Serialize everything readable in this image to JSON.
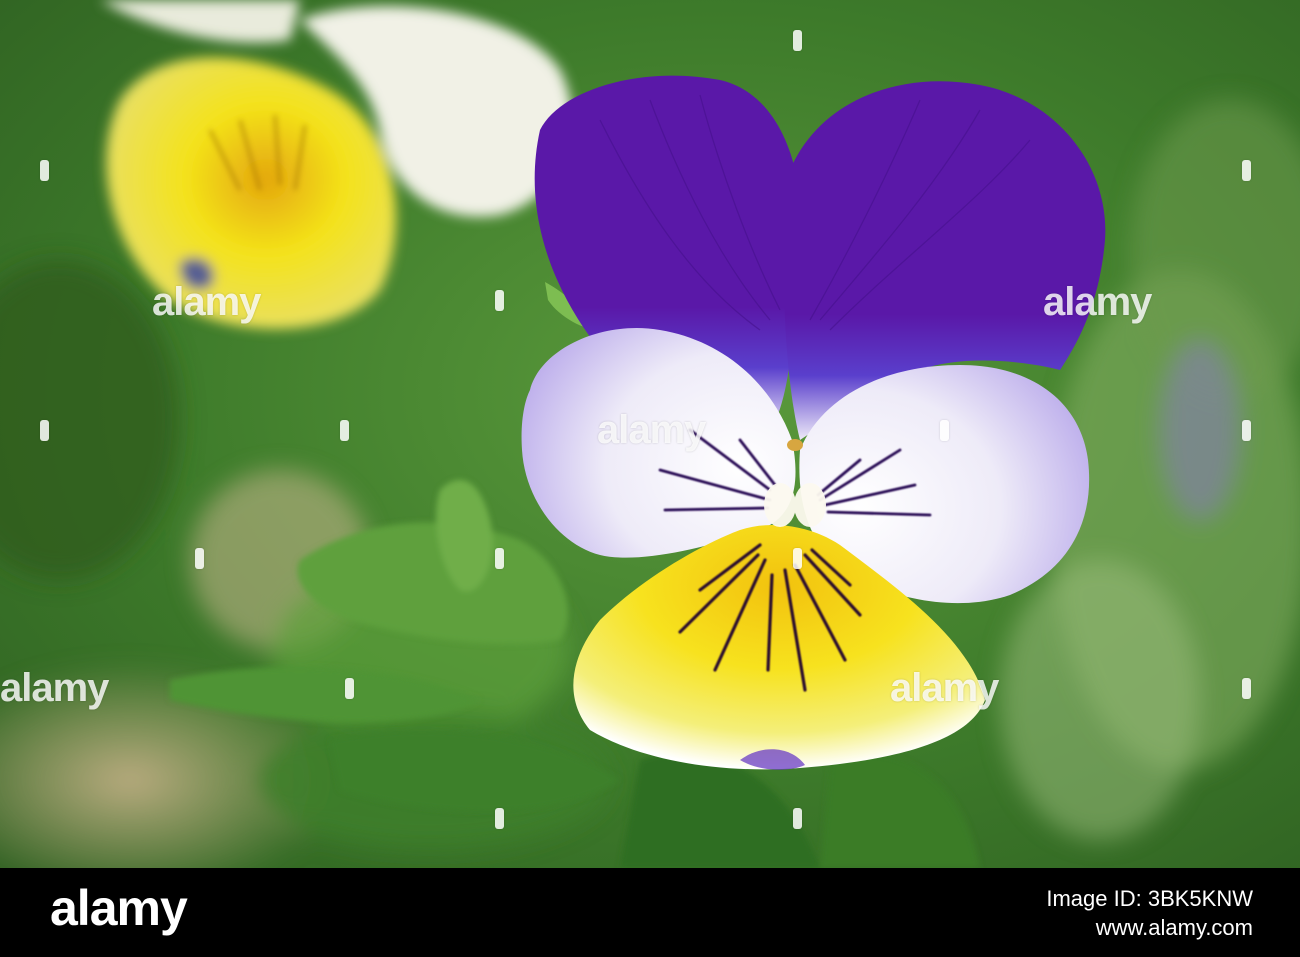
{
  "photo": {
    "subject": "viola-tricolor-flower",
    "colors": {
      "upper_petals": "#5a1aa6",
      "side_petals": "#f1eefa",
      "lip_yellow": "#f6e01a",
      "background_green": "#3f7a2c",
      "veins": "#2a0a3a"
    }
  },
  "watermark": {
    "text": "alamy",
    "instances": [
      1,
      2,
      3,
      4,
      5,
      6,
      7,
      8,
      9,
      10,
      11,
      12,
      13,
      14,
      15
    ]
  },
  "footer": {
    "logo": "alamy",
    "line1": "Image ID: 3BK5KNW",
    "line2": "www.alamy.com"
  }
}
